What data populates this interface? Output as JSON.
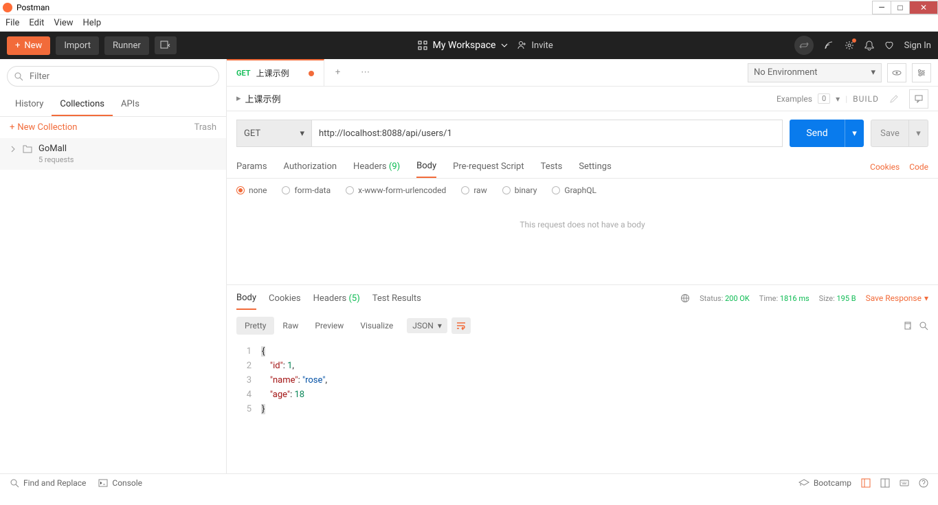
{
  "window": {
    "title": "Postman"
  },
  "menubar": [
    "File",
    "Edit",
    "View",
    "Help"
  ],
  "topbar": {
    "new": "New",
    "import": "Import",
    "runner": "Runner",
    "workspace": "My Workspace",
    "invite": "Invite",
    "signin": "Sign In"
  },
  "sidebar": {
    "filter_placeholder": "Filter",
    "tabs": [
      "History",
      "Collections",
      "APIs"
    ],
    "active_tab": 1,
    "new_collection": "New Collection",
    "trash": "Trash",
    "collection": {
      "name": "GoMall",
      "meta": "5 requests"
    }
  },
  "request_tab": {
    "method": "GET",
    "name": "上课示例"
  },
  "env": {
    "label": "No Environment"
  },
  "breadcrumb": "上课示例",
  "examples": {
    "label": "Examples",
    "count": "0"
  },
  "build": "BUILD",
  "url_method": "GET",
  "url": "http://localhost:8088/api/users/1",
  "send": "Send",
  "save": "Save",
  "req_tabs": {
    "params": "Params",
    "authorization": "Authorization",
    "headers": "Headers",
    "headers_count": "(9)",
    "body": "Body",
    "prerequest": "Pre-request Script",
    "tests": "Tests",
    "settings": "Settings",
    "cookies": "Cookies",
    "code": "Code"
  },
  "body_types": [
    "none",
    "form-data",
    "x-www-form-urlencoded",
    "raw",
    "binary",
    "GraphQL"
  ],
  "no_body_msg": "This request does not have a body",
  "resp_tabs": {
    "body": "Body",
    "cookies": "Cookies",
    "headers": "Headers",
    "headers_count": "(5)",
    "test_results": "Test Results"
  },
  "resp_status": {
    "status_label": "Status:",
    "status_value": "200 OK",
    "time_label": "Time:",
    "time_value": "1816 ms",
    "size_label": "Size:",
    "size_value": "195 B",
    "save_response": "Save Response"
  },
  "resp_views": {
    "pretty": "Pretty",
    "raw": "Raw",
    "preview": "Preview",
    "visualize": "Visualize",
    "format": "JSON"
  },
  "response_json": {
    "id": 1,
    "name": "rose",
    "age": 18
  },
  "footer": {
    "find": "Find and Replace",
    "console": "Console",
    "bootcamp": "Bootcamp"
  }
}
